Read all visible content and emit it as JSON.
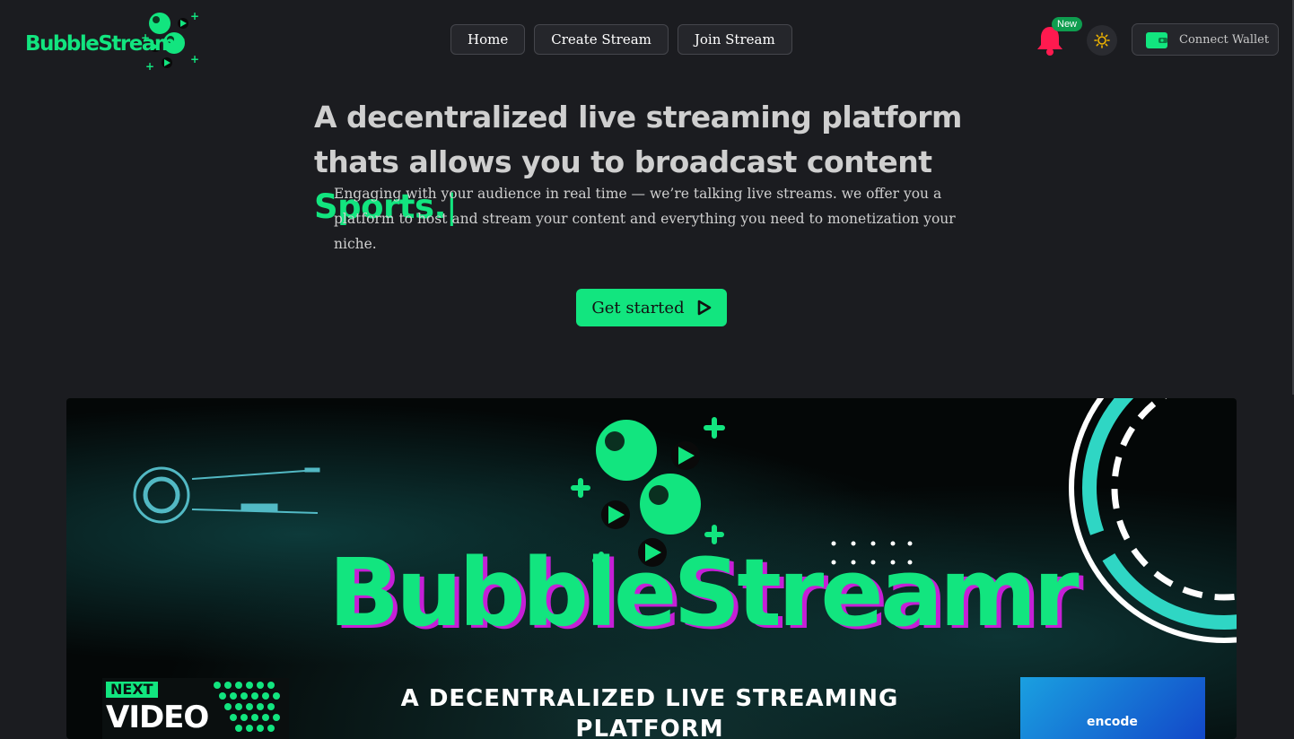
{
  "navbar": {
    "logo_text": "BubbleStreamr",
    "links": [
      {
        "label": "Home"
      },
      {
        "label": "Create Stream"
      },
      {
        "label": "Join Stream"
      }
    ],
    "notification_badge": "New",
    "wallet_label": "Connect Wallet",
    "bell_color": "#ff1a4f",
    "accent": "#12e57f"
  },
  "hero": {
    "title": "A decentralized live streaming platform thats allows you to broadcast content",
    "typed_word": "Sports.",
    "caret": "|",
    "description": "Engaging with your audience in real time — we’re talking live streams. we offer you a platform to host and stream your content and everything you need to monetization your niche.",
    "cta_label": "Get started"
  },
  "banner": {
    "brand": "BubbleStreamr",
    "tagline": "A DECENTRALIZED LIVE STREAMING PLATFORM",
    "next_label": "NEXT",
    "video_label": "VIDEO",
    "encode_label": "encode"
  }
}
